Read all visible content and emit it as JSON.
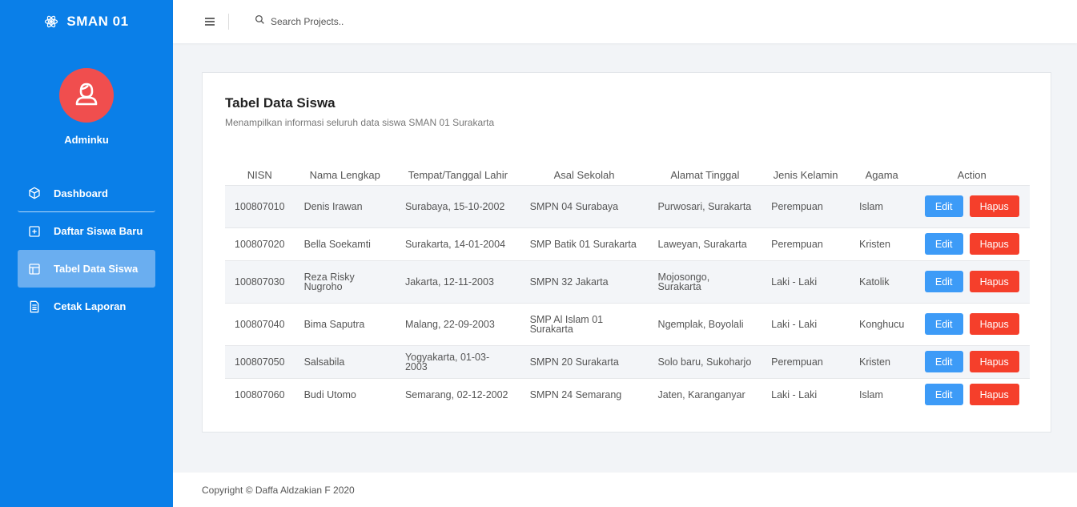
{
  "sidebar": {
    "brand": "SMAN 01",
    "username": "Adminku",
    "items": [
      {
        "label": "Dashboard",
        "icon": "cube-icon"
      },
      {
        "label": "Daftar Siswa Baru",
        "icon": "plus-square-icon"
      },
      {
        "label": "Tabel Data Siswa",
        "icon": "layout-icon",
        "active": true
      },
      {
        "label": "Cetak Laporan",
        "icon": "file-text-icon"
      }
    ]
  },
  "topbar": {
    "search_placeholder": "Search Projects.."
  },
  "card": {
    "title": "Tabel Data Siswa",
    "subtitle": "Menampilkan informasi seluruh data siswa SMAN 01 Surakarta"
  },
  "table": {
    "headers": [
      "NISN",
      "Nama Lengkap",
      "Tempat/Tanggal Lahir",
      "Asal Sekolah",
      "Alamat Tinggal",
      "Jenis Kelamin",
      "Agama",
      "Action"
    ],
    "rows": [
      {
        "nisn": "100807010",
        "nama": "Denis Irawan",
        "ttl": "Surabaya, 15-10-2002",
        "sekolah": "SMPN 04 Surabaya",
        "alamat": "Purwosari, Surakarta",
        "jk": "Perempuan",
        "agama": "Islam"
      },
      {
        "nisn": "100807020",
        "nama": "Bella Soekamti",
        "ttl": "Surakarta, 14-01-2004",
        "sekolah": "SMP Batik 01 Surakarta",
        "alamat": "Laweyan, Surakarta",
        "jk": "Perempuan",
        "agama": "Kristen"
      },
      {
        "nisn": "100807030",
        "nama": "Reza Risky Nugroho",
        "ttl": "Jakarta, 12-11-2003",
        "sekolah": "SMPN 32 Jakarta",
        "alamat": "Mojosongo, Surakarta",
        "jk": "Laki - Laki",
        "agama": "Katolik"
      },
      {
        "nisn": "100807040",
        "nama": "Bima Saputra",
        "ttl": "Malang, 22-09-2003",
        "sekolah": "SMP Al Islam 01 Surakarta",
        "alamat": "Ngemplak, Boyolali",
        "jk": "Laki - Laki",
        "agama": "Konghucu"
      },
      {
        "nisn": "100807050",
        "nama": "Salsabila",
        "ttl": "Yogyakarta, 01-03-2003",
        "sekolah": "SMPN 20 Surakarta",
        "alamat": "Solo baru, Sukoharjo",
        "jk": "Perempuan",
        "agama": "Kristen"
      },
      {
        "nisn": "100807060",
        "nama": "Budi Utomo",
        "ttl": "Semarang, 02-12-2002",
        "sekolah": "SMPN 24 Semarang",
        "alamat": "Jaten, Karanganyar",
        "jk": "Laki - Laki",
        "agama": "Islam"
      }
    ],
    "edit_label": "Edit",
    "hapus_label": "Hapus"
  },
  "footer": {
    "copyright": "Copyright © Daffa Aldzakian F 2020"
  },
  "colors": {
    "sidebar_bg": "#0a7fe8",
    "avatar_bg": "#f04e4e",
    "edit_btn": "#3d9bf7",
    "hapus_btn": "#f53f2b"
  }
}
